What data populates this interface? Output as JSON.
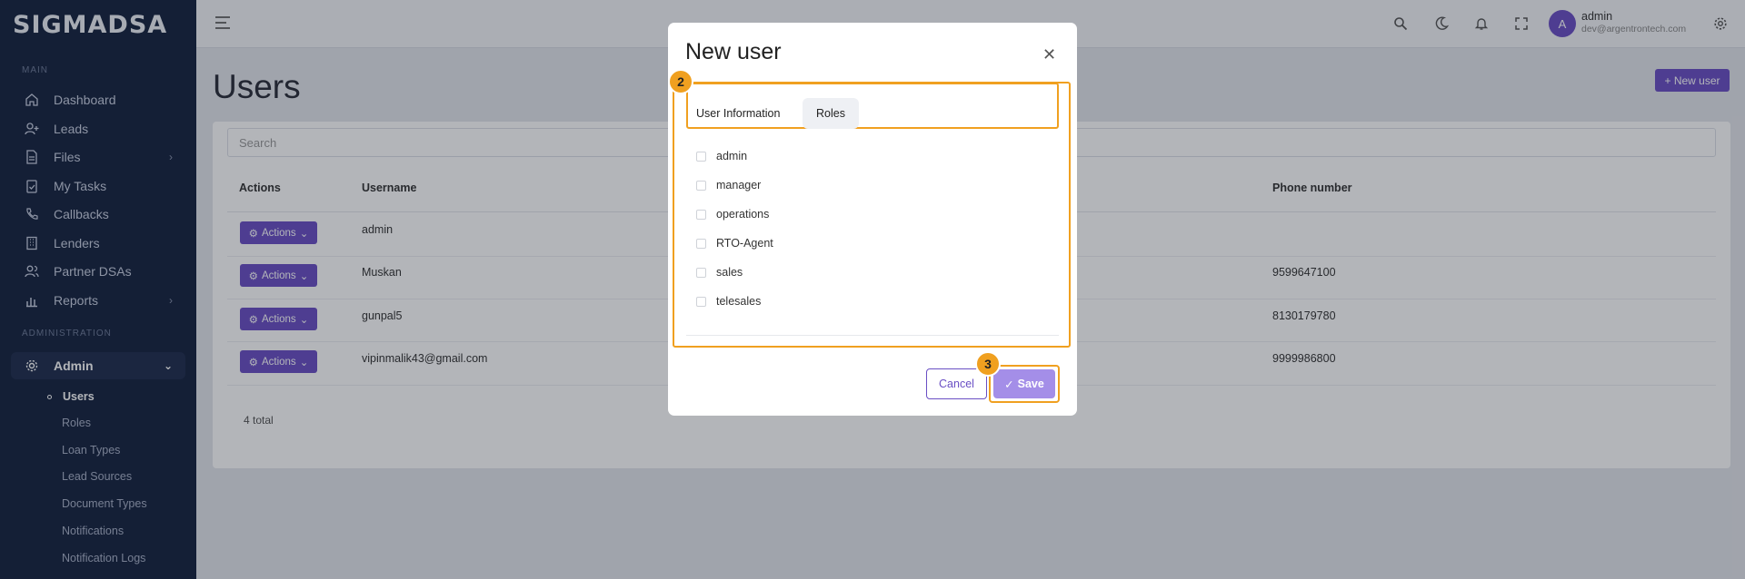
{
  "brand": "SIGMADSA",
  "sidebar": {
    "main_label": "MAIN",
    "admin_label": "ADMINISTRATION",
    "items": [
      {
        "label": "Dashboard",
        "icon": "home-icon"
      },
      {
        "label": "Leads",
        "icon": "user-plus-icon"
      },
      {
        "label": "Files",
        "icon": "file-icon"
      },
      {
        "label": "My Tasks",
        "icon": "clipboard-icon"
      },
      {
        "label": "Callbacks",
        "icon": "phone-icon"
      },
      {
        "label": "Lenders",
        "icon": "building-icon"
      },
      {
        "label": "Partner DSAs",
        "icon": "users-icon"
      },
      {
        "label": "Reports",
        "icon": "bar-chart-icon"
      }
    ],
    "admin": {
      "label": "Admin",
      "icon": "gear-icon"
    },
    "sub_items": [
      "Users",
      "Roles",
      "Loan Types",
      "Lead Sources",
      "Document Types",
      "Notifications",
      "Notification Logs"
    ]
  },
  "topbar": {
    "avatar_initial": "A",
    "user_name": "admin",
    "user_email": "dev@argentrontech.com"
  },
  "main": {
    "title": "Users",
    "new_user_label": "+ New user",
    "search_placeholder": "Search",
    "columns": [
      "Actions",
      "Username",
      "Phone number"
    ],
    "action_label": "Actions",
    "rows": [
      {
        "username": "admin",
        "phone": ""
      },
      {
        "username": "Muskan",
        "phone": "9599647100"
      },
      {
        "username": "gunpal5",
        "phone": "8130179780"
      },
      {
        "username": "vipinmalik43@gmail.com",
        "phone": "9999986800"
      }
    ],
    "total": "4 total"
  },
  "modal": {
    "title": "New user",
    "tabs": [
      "User Information",
      "Roles"
    ],
    "roles": [
      "admin",
      "manager",
      "operations",
      "RTO-Agent",
      "sales",
      "telesales"
    ],
    "cancel_label": "Cancel",
    "save_label": "Save",
    "badges": [
      "2",
      "3"
    ]
  },
  "colors": {
    "accent": "#6a4fc4",
    "highlight": "#f0a020",
    "sidebar_bg": "#15223f"
  }
}
